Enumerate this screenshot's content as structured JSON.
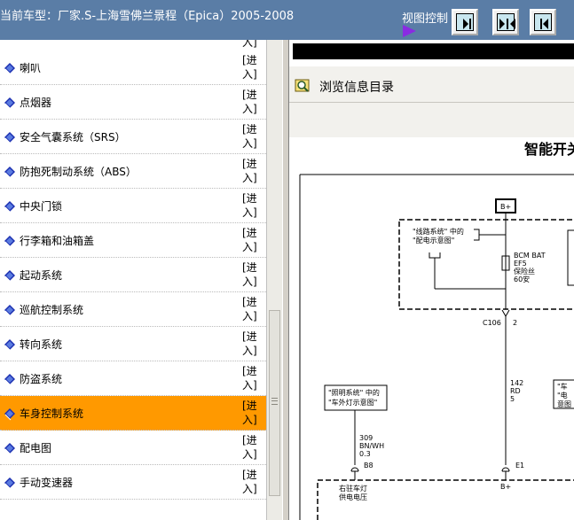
{
  "header": {
    "title": "当前车型：厂家.S-上海雪佛兰景程（Epica）2005-2008",
    "view_control_label": "视图控制",
    "buttons": [
      {
        "name": "expand-right-button",
        "icon": "arrow-right-bar-icon"
      },
      {
        "name": "split-view-button",
        "icon": "arrows-inward-icon"
      },
      {
        "name": "collapse-left-button",
        "icon": "arrow-left-bar-icon"
      }
    ]
  },
  "sidebar": {
    "top_partial": "入]",
    "items": [
      {
        "label": "喇叭",
        "enter": "[进入]"
      },
      {
        "label": "点烟器",
        "enter": "[进入]"
      },
      {
        "label": "安全气囊系统（SRS）",
        "enter": "[进入]"
      },
      {
        "label": "防抱死制动系统（ABS）",
        "enter": "[进入]"
      },
      {
        "label": "中央门锁",
        "enter": "[进入]"
      },
      {
        "label": "行李箱和油箱盖",
        "enter": "[进入]"
      },
      {
        "label": "起动系统",
        "enter": "[进入]"
      },
      {
        "label": "巡航控制系统",
        "enter": "[进入]"
      },
      {
        "label": "转向系统",
        "enter": "[进入]"
      },
      {
        "label": "防盗系统",
        "enter": "[进入]"
      },
      {
        "label": "车身控制系统",
        "enter": "[进入]",
        "selected": true
      },
      {
        "label": "配电图",
        "enter": "[进入]"
      },
      {
        "label": "手动变速器",
        "enter": "[进入]"
      }
    ]
  },
  "browse": {
    "label": "浏览信息目录"
  },
  "diagram": {
    "title": "智能开关",
    "bplus_top": "B+",
    "note_line_system_1": "\"线路系统\" 中的",
    "note_line_system_2": "\"配电示意图\"",
    "fuse_1": "BCM BAT",
    "fuse_2": "EF5",
    "fuse_3": "保险丝",
    "fuse_4": "60安",
    "c106": "C106",
    "pin_2": "2",
    "wire_142": "142",
    "wire_rd": "RD",
    "wire_5": "5",
    "note_lighting_1": "\"照明系统\" 中的",
    "note_lighting_2": "\"车外灯示意图\"",
    "wire_309": "309",
    "wire_bnwh": "BN/WH",
    "wire_03": "0.3",
    "pin_b8": "B8",
    "pin_e1": "E1",
    "label_right_lamp_1": "右驻车灯",
    "label_right_lamp_2": "供电电压",
    "bplus_bottom": "B+",
    "right_note_1": "\"车",
    "right_note_2": "\"电",
    "right_note_3": "意图"
  },
  "colors": {
    "header_bg": "#5a7da6",
    "selected_bg": "#ff9900",
    "item_icon": "#1a2fb0"
  }
}
